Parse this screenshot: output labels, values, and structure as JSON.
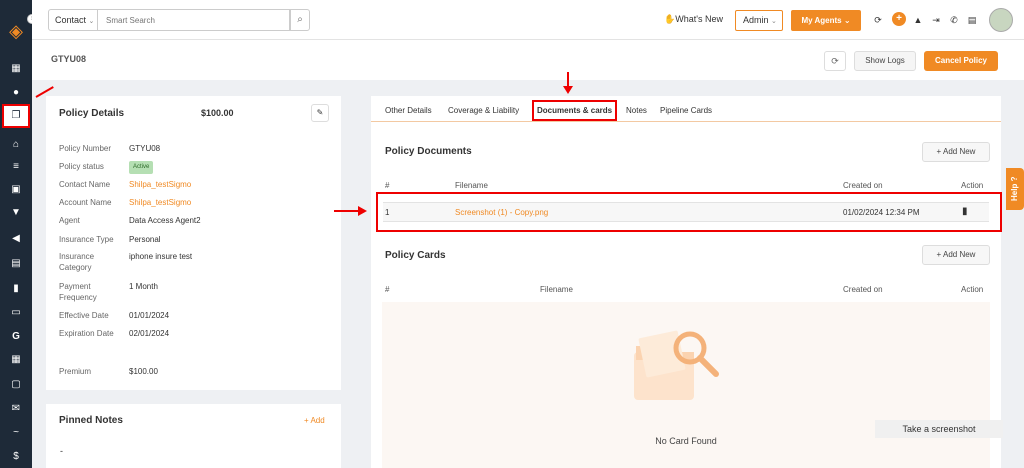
{
  "topbar": {
    "context_select": "Contact",
    "search_placeholder": "Smart Search",
    "whats_new": "What's New",
    "admin_select": "Admin",
    "my_agents": "My Agents"
  },
  "page": {
    "title": "GTYU08",
    "show_logs": "Show Logs",
    "cancel_policy": "Cancel Policy"
  },
  "policy_details": {
    "title": "Policy Details",
    "amount": "$100.00",
    "fields": [
      {
        "label": "Policy Number",
        "value": "GTYU08"
      },
      {
        "label": "Policy status",
        "value": "Active"
      },
      {
        "label": "Contact Name",
        "value": "Shilpa_testSigmo"
      },
      {
        "label": "Account Name",
        "value": "Shilpa_testSigmo"
      },
      {
        "label": "Agent",
        "value": "Data Access Agent2"
      },
      {
        "label": "Insurance Type",
        "value": "Personal"
      },
      {
        "label": "Insurance Category",
        "value": "iphone insure test"
      },
      {
        "label": "Payment Frequency",
        "value": "1 Month"
      },
      {
        "label": "Effective Date",
        "value": "01/01/2024"
      },
      {
        "label": "Expiration Date",
        "value": "02/01/2024"
      },
      {
        "label": "Premium",
        "value": "$100.00"
      }
    ]
  },
  "pinned_notes": {
    "title": "Pinned Notes",
    "add": "+ Add",
    "content": "-"
  },
  "tabs": [
    {
      "label": "Other Details"
    },
    {
      "label": "Coverage & Liability"
    },
    {
      "label": "Documents & cards"
    },
    {
      "label": "Notes"
    },
    {
      "label": "Pipeline Cards"
    }
  ],
  "policy_documents": {
    "title": "Policy Documents",
    "add_new": "+ Add New",
    "columns": [
      "#",
      "Filename",
      "Created on",
      "Action"
    ],
    "rows": [
      {
        "num": "1",
        "filename": "Screenshot (1) - Copy.png",
        "created_on": "01/02/2024 12:34 PM"
      }
    ]
  },
  "policy_cards": {
    "title": "Policy Cards",
    "add_new": "+ Add New",
    "columns": [
      "#",
      "Filename",
      "Created on",
      "Action"
    ],
    "empty_text": "No Card Found"
  },
  "help_tab": "Help",
  "screenshot_tip": "Take a screenshot",
  "colors": {
    "accent": "#f08a24",
    "sidebar": "#1e2a38",
    "highlight": "#e00000"
  }
}
